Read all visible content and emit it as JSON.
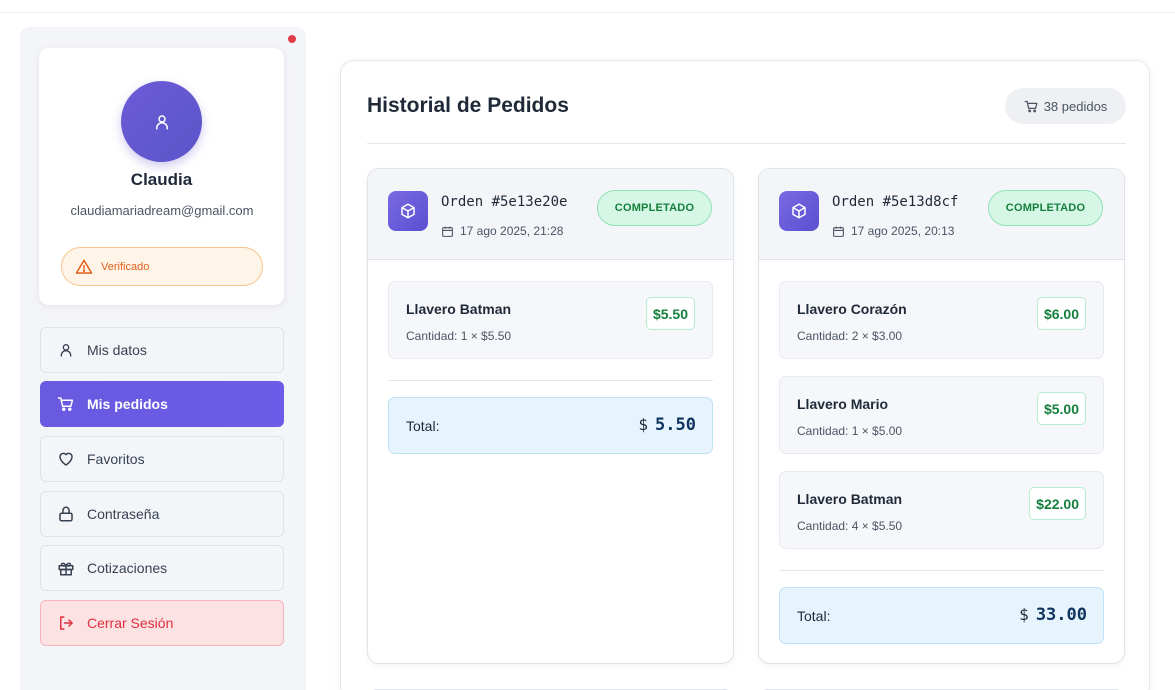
{
  "profile": {
    "name": "Claudia",
    "email": "claudiamariadream@gmail.com",
    "verified_label": "Verificado"
  },
  "sidebar": {
    "items": [
      {
        "label": "Mis datos",
        "icon": "user-icon"
      },
      {
        "label": "Mis pedidos",
        "icon": "cart-icon",
        "active": true
      },
      {
        "label": "Favoritos",
        "icon": "heart-icon"
      },
      {
        "label": "Contraseña",
        "icon": "lock-icon"
      },
      {
        "label": "Cotizaciones",
        "icon": "gift-icon"
      },
      {
        "label": "Cerrar Sesión",
        "icon": "logout-icon"
      }
    ]
  },
  "main": {
    "title": "Historial de Pedidos",
    "order_count": "38 pedidos"
  },
  "orders": [
    {
      "id": "Orden #5e13e20e",
      "date": "17 ago 2025, 21:28",
      "status": "COMPLETADO",
      "items": [
        {
          "name": "Llavero Batman",
          "qty": "Cantidad: 1 × $5.50",
          "price": "$5.50"
        }
      ],
      "total_label": "Total:",
      "currency": "$",
      "total": "5.50"
    },
    {
      "id": "Orden #5e13d8cf",
      "date": "17 ago 2025, 20:13",
      "status": "COMPLETADO",
      "items": [
        {
          "name": "Llavero Corazón",
          "qty": "Cantidad: 2 × $3.00",
          "price": "$6.00"
        },
        {
          "name": "Llavero Mario",
          "qty": "Cantidad: 1 × $5.00",
          "price": "$5.00"
        },
        {
          "name": "Llavero Batman",
          "qty": "Cantidad: 4 × $5.50",
          "price": "$22.00"
        }
      ],
      "total_label": "Total:",
      "currency": "$",
      "total": "33.00"
    }
  ],
  "colors": {
    "accent": "#6c5ce7",
    "success": "#15803d",
    "danger": "#e0303f",
    "warning": "#e0601b"
  }
}
